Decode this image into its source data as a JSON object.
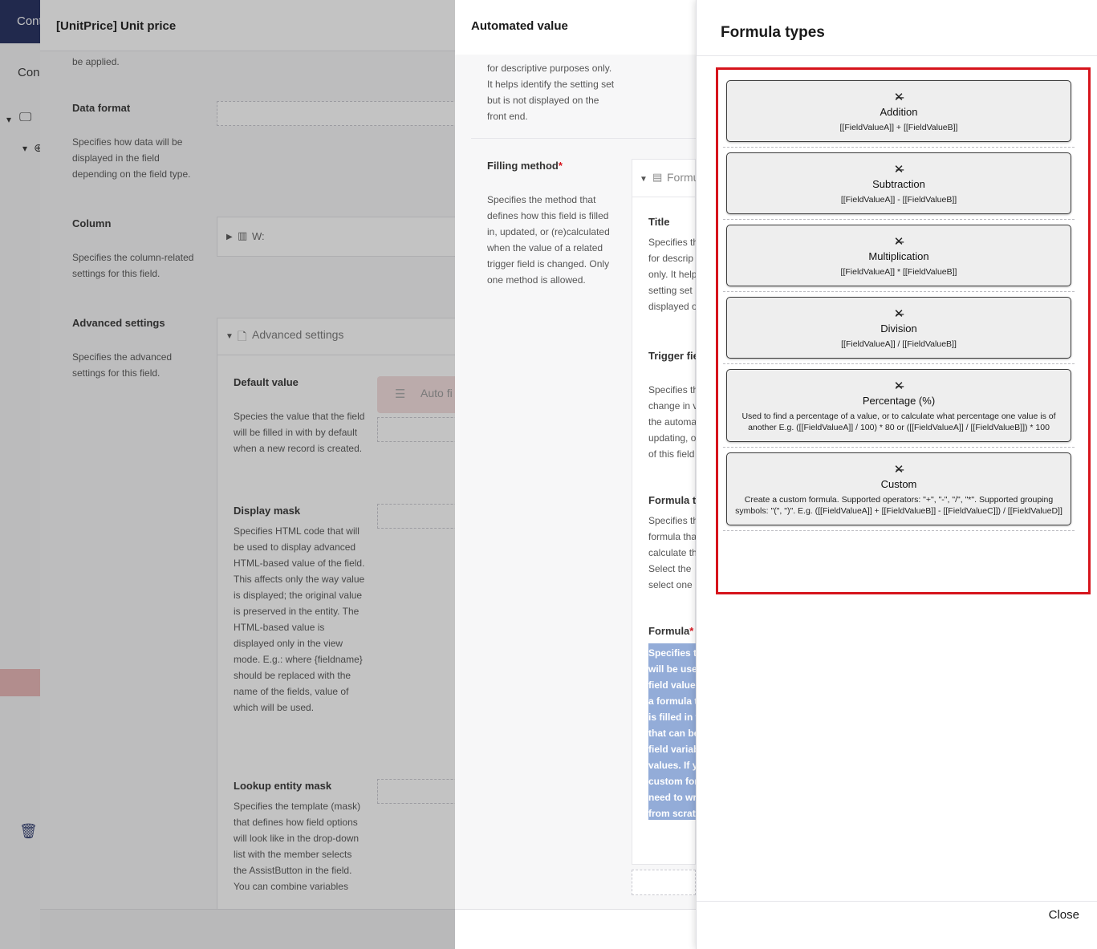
{
  "app": {
    "header_tab": "Cont",
    "sub_label": "Con"
  },
  "field_editor": {
    "title": "[UnitPrice] Unit price",
    "top_desc": "be applied.",
    "data_format": {
      "label": "Data format",
      "desc": "Specifies how data will be displayed in the field depending on the field type."
    },
    "column": {
      "label": "Column",
      "desc": "Specifies the column-related settings for this field.",
      "value": "W:"
    },
    "advanced": {
      "label": "Advanced settings",
      "desc": "Specifies the advanced settings for this field.",
      "section_title": "Advanced settings",
      "auto_fill_label": "Auto fi",
      "default_value": {
        "label": "Default value",
        "desc": "Species the value that the field will be filled in with by default when a new record is created."
      },
      "display_mask": {
        "label": "Display mask",
        "desc": "Specifies HTML code that will be used to display advanced HTML-based value of the field. This affects only the way value is displayed; the original value is preserved in the entity. The HTML-based value is displayed only in the view mode. E.g.:        where {fieldname} should be replaced with the name of the fields, value of which will be used."
      },
      "lookup_mask": {
        "label": "Lookup entity mask",
        "desc": "Specifies the template (mask) that defines how field options will look like in the drop-down list with the member selects the AssistButton in the field. You can combine variables"
      }
    }
  },
  "automated_value": {
    "title": "Automated value",
    "top_desc": "for descriptive purposes only. It helps identify the setting set but is not displayed on the front end.",
    "filling_method": {
      "label": "Filling method",
      "required_mark": "*",
      "desc": "Specifies the method that defines how this field is filled in, updated, or (re)calculated when the value of a related trigger field is changed. Only one method is allowed.",
      "selected": "Formula"
    },
    "inner": {
      "title_label": "Title",
      "title_desc": "Specifies the\nfor descrip\nonly. It help\nsetting set\ndisplayed o",
      "trigger_label": "Trigger fie",
      "trigger_desc": "Specifies th\nchange in v\nthe automa\nupdating, o\nof this field",
      "formula_type_label": "Formula t",
      "formula_type_desc": "Specifies th\nformula tha\ncalculate th\nSelect the\nselect one",
      "formula_label": "Formula",
      "formula_required": "*",
      "formula_desc": "Specifies th\nwill be used\nfield value.\na formula t\nis filled in w\nthat can be\nfield variab\nvalues. If yo\ncustom form\nneed to wri\nfrom scrat"
    }
  },
  "formula_types": {
    "title": "Formula types",
    "close_label": "Close",
    "items": [
      {
        "name": "Addition",
        "desc": "[[FieldValueA]] + [[FieldValueB]]",
        "icon": "calculator-icon"
      },
      {
        "name": "Subtraction",
        "desc": "[[FieldValueA]] - [[FieldValueB]]",
        "icon": "calculator-icon"
      },
      {
        "name": "Multiplication",
        "desc": "[[FieldValueA]] * [[FieldValueB]]",
        "icon": "calculator-icon"
      },
      {
        "name": "Division",
        "desc": "[[FieldValueA]] / [[FieldValueB]]",
        "icon": "calculator-icon"
      },
      {
        "name": "Percentage (%)",
        "desc": "Used to find a percentage of a value, or to calculate what percentage one value is of another E.g. ([[FieldValueA]] / 100) * 80 or ([[FieldValueA]] / [[FieldValueB]]) * 100",
        "icon": "calculator-icon"
      },
      {
        "name": "Custom",
        "desc": "Create a custom formula. Supported operators: \"+\", \"-\", \"/\", \"*\". Supported grouping symbols: \"(\", \")\". E.g. ([[FieldValueA]] + [[FieldValueB]] - [[FieldValueC]]) / [[FieldValueD]]",
        "icon": "calculator-icon"
      }
    ]
  },
  "colors": {
    "highlight": "#d6141c",
    "header": "#1f2a5c",
    "selection": "#93acd8"
  }
}
